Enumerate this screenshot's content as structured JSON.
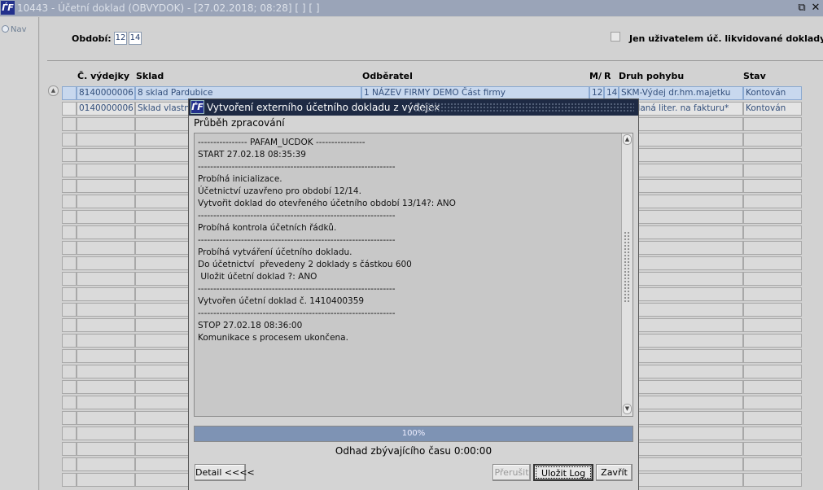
{
  "window": {
    "title": "10443 - Účetní doklad (OBVYDOK) - [27.02.2018; 08:28]  [ ]  [ ]",
    "logo_text": "ЃF",
    "restore_glyph": "⧉",
    "close_glyph": "✕"
  },
  "nav": {
    "label": "Nav"
  },
  "filters": {
    "period_label": "Období:",
    "period_values": [
      "12",
      "14"
    ],
    "only_user_label": "Jen uživatelem úč. likvidované doklady"
  },
  "table": {
    "headers": {
      "cislo": "Č. výdejky",
      "sklad": "Sklad",
      "odberatel": "Odběratel",
      "m": "M/",
      "r": "R",
      "druh": "Druh pohybu",
      "stav": "Stav"
    },
    "rows": [
      {
        "cislo": "8140000006",
        "sklad": "8  sklad Pardubice",
        "odberatel": "1 NÁZEV FIRMY DEMO Část firmy",
        "m": "12",
        "r": "14",
        "druh": "SKM-Výdej dr.hm.majetku",
        "stav": "Kontován"
      },
      {
        "cislo": "0140000006",
        "sklad": "Sklad vlastní",
        "odberatel": "",
        "m": "",
        "r": "",
        "druh": "Prodaná liter. na fakturu*",
        "stav": "Kontován"
      }
    ],
    "scroll_up_glyph": "▲"
  },
  "dialog": {
    "title": "Vytvoření externího účetního dokladu z výdejek",
    "subtitle": "Průběh zpracování",
    "log_lines": [
      "---------------- PAFAM_UCDOK ----------------",
      "START 27.02.18 08:35:39",
      "----------------------------------------------------------------",
      "Probíhá inicializace.",
      "Účetnictví uzavřeno pro období 12/14.",
      "Vytvořit doklad do otevřeného účetního období 13/14?: ANO",
      "----------------------------------------------------------------",
      "Probíhá kontrola účetních řádků.",
      "----------------------------------------------------------------",
      "Probíhá vytváření účetního dokladu.",
      "Do účetnictví  převedeny 2 doklady s částkou 600",
      " Uložit účetní doklad ?: ANO",
      "----------------------------------------------------------------",
      "Vytvořen účetní doklad č. 1410400359",
      "----------------------------------------------------------------",
      "STOP 27.02.18 08:36:00",
      "Komunikace s procesem ukončena."
    ],
    "progress_percent": 100,
    "progress_label": "100%",
    "eta": "Odhad zbývajícího času 0:00:00",
    "buttons": {
      "detail": "Detail <<<<",
      "interrupt": "Přerušit",
      "save_log": "Uložit Log",
      "close": "Zavřít"
    },
    "scroll_up_glyph": "▲",
    "scroll_down_glyph": "▼"
  }
}
